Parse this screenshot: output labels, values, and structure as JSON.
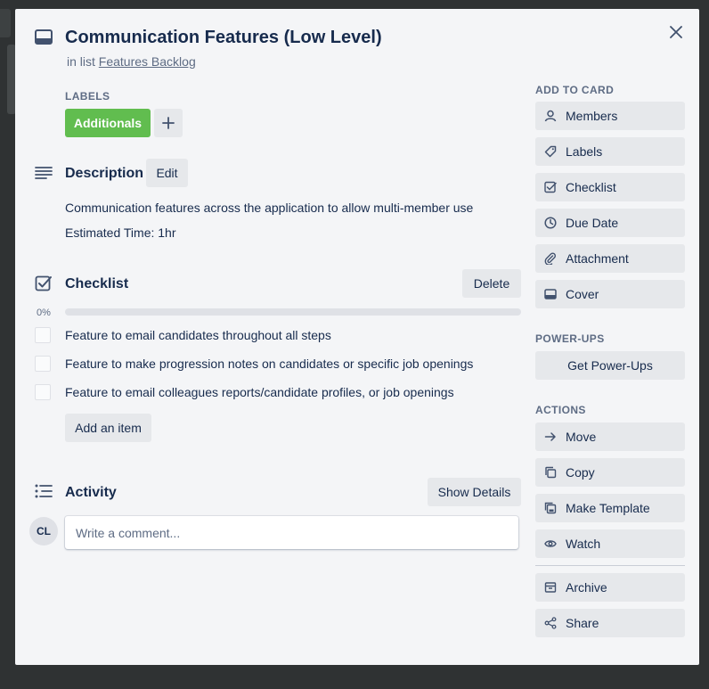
{
  "card": {
    "title": "Communication Features (Low Level)",
    "list_prefix": "in list",
    "list_name": "Features Backlog"
  },
  "labels": {
    "heading": "LABELS",
    "items": [
      {
        "text": "Additionals",
        "color": "#61bd4f"
      }
    ],
    "add_symbol": "+"
  },
  "description": {
    "heading": "Description",
    "edit_label": "Edit",
    "lines": [
      "Communication features across the application to allow multi-member use",
      "Estimated Time: 1hr"
    ]
  },
  "checklist": {
    "heading": "Checklist",
    "delete_label": "Delete",
    "progress_text": "0%",
    "progress": 0,
    "items": [
      {
        "text": "Feature to email candidates throughout all steps",
        "checked": false
      },
      {
        "text": "Feature to make progression notes on candidates or specific job openings",
        "checked": false
      },
      {
        "text": "Feature to email colleagues reports/candidate profiles, or job openings",
        "checked": false
      }
    ],
    "add_item_label": "Add an item"
  },
  "activity": {
    "heading": "Activity",
    "show_details_label": "Show Details",
    "avatar_initials": "CL",
    "comment_placeholder": "Write a comment..."
  },
  "sidebar": {
    "add_to_card": {
      "heading": "ADD TO CARD",
      "items": [
        {
          "label": "Members",
          "icon": "person-icon"
        },
        {
          "label": "Labels",
          "icon": "tag-icon"
        },
        {
          "label": "Checklist",
          "icon": "checkbox-icon"
        },
        {
          "label": "Due Date",
          "icon": "clock-icon"
        },
        {
          "label": "Attachment",
          "icon": "paperclip-icon"
        },
        {
          "label": "Cover",
          "icon": "card-cover-icon"
        }
      ]
    },
    "power_ups": {
      "heading": "POWER-UPS",
      "button_label": "Get Power-Ups"
    },
    "actions": {
      "heading": "ACTIONS",
      "items": [
        {
          "label": "Move",
          "icon": "arrow-right-icon"
        },
        {
          "label": "Copy",
          "icon": "copy-icon"
        },
        {
          "label": "Make Template",
          "icon": "template-icon"
        },
        {
          "label": "Watch",
          "icon": "eye-icon"
        },
        {
          "label": "Archive",
          "icon": "archive-icon"
        },
        {
          "label": "Share",
          "icon": "share-icon"
        }
      ]
    }
  },
  "colors": {
    "modal_bg": "#f4f5f7",
    "backdrop": "#2f3233",
    "button_bg": "#e6e8eb",
    "text": "#172b4d",
    "muted_text": "#5e6c84",
    "progress_fill": "#5ba4cf"
  }
}
